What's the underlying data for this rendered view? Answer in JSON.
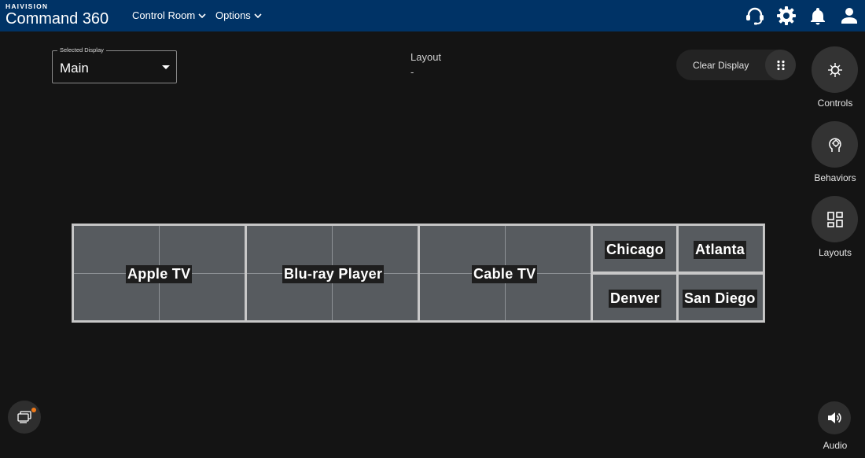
{
  "header": {
    "brand_small": "HAIVISION",
    "brand_title": "Command 360",
    "nav": [
      {
        "label": "Control Room"
      },
      {
        "label": "Options"
      }
    ],
    "icons": [
      "support-headset-icon",
      "settings-gear-icon",
      "notifications-bell-icon",
      "user-account-icon"
    ]
  },
  "display_select": {
    "legend": "Selected Display",
    "value": "Main"
  },
  "layout": {
    "label": "Layout",
    "value": "-"
  },
  "toolbar": {
    "clear_label": "Clear Display"
  },
  "rail": [
    {
      "label": "Controls",
      "icon": "controls-icon"
    },
    {
      "label": "Behaviors",
      "icon": "behaviors-icon"
    },
    {
      "label": "Layouts",
      "icon": "layouts-grid-icon"
    }
  ],
  "wall": {
    "sources": [
      {
        "label": "Apple TV"
      },
      {
        "label": "Blu-ray Player"
      },
      {
        "label": "Cable TV"
      },
      {
        "label": "Chicago"
      },
      {
        "label": "Atlanta"
      },
      {
        "label": "Denver"
      },
      {
        "label": "San Diego"
      }
    ]
  },
  "bottom": {
    "audio_label": "Audio"
  },
  "colors": {
    "header_bg": "#003366",
    "page_bg": "#141414",
    "tile_bg": "#575b5f",
    "notification_dot": "#f07a1a"
  }
}
